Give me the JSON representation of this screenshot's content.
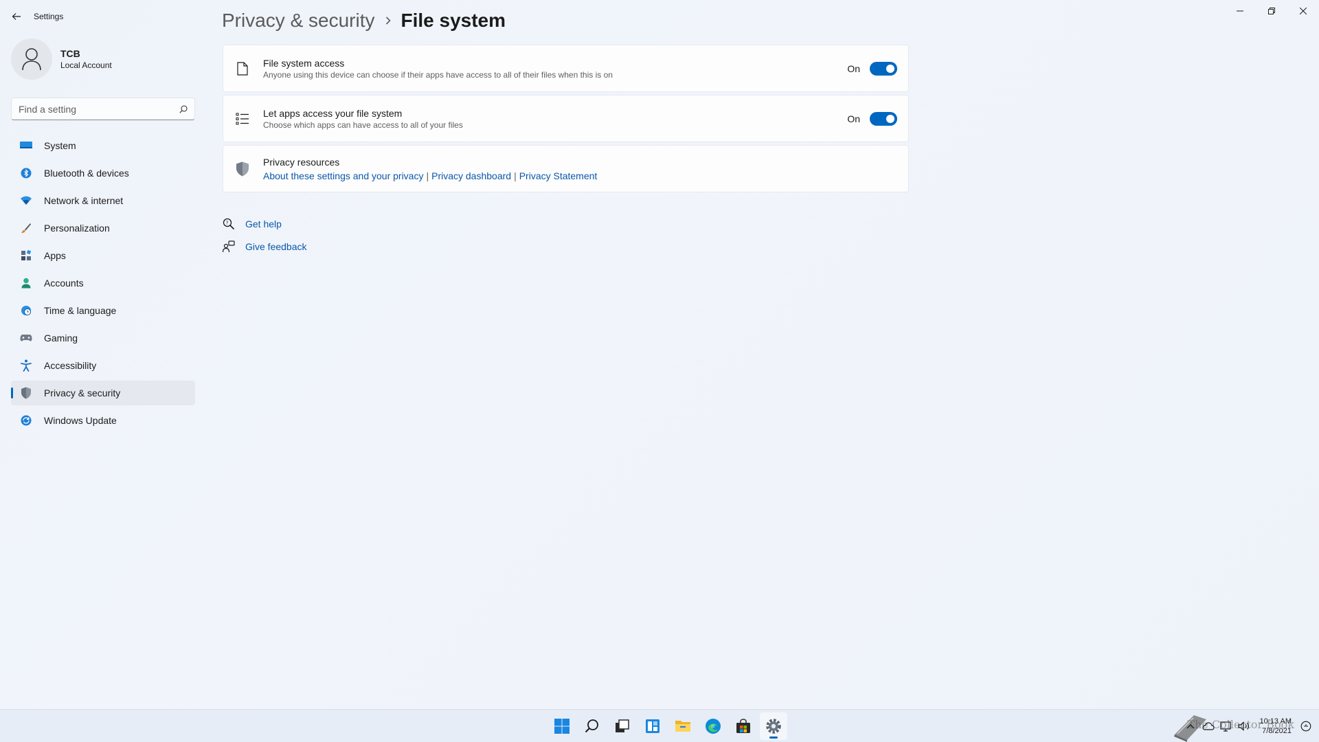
{
  "app": {
    "title": "Settings"
  },
  "profile": {
    "name": "TCB",
    "account_type": "Local Account"
  },
  "search": {
    "placeholder": "Find a setting"
  },
  "sidebar": {
    "items": [
      {
        "label": "System",
        "icon": "system-icon"
      },
      {
        "label": "Bluetooth & devices",
        "icon": "bluetooth-icon"
      },
      {
        "label": "Network & internet",
        "icon": "wifi-icon"
      },
      {
        "label": "Personalization",
        "icon": "brush-icon"
      },
      {
        "label": "Apps",
        "icon": "apps-icon"
      },
      {
        "label": "Accounts",
        "icon": "person-icon"
      },
      {
        "label": "Time & language",
        "icon": "globe-clock-icon"
      },
      {
        "label": "Gaming",
        "icon": "controller-icon"
      },
      {
        "label": "Accessibility",
        "icon": "accessibility-icon"
      },
      {
        "label": "Privacy & security",
        "icon": "shield-icon",
        "active": true
      },
      {
        "label": "Windows Update",
        "icon": "update-icon"
      }
    ]
  },
  "breadcrumb": {
    "parent": "Privacy & security",
    "current": "File system"
  },
  "cards": {
    "file_system_access": {
      "title": "File system access",
      "description": "Anyone using this device can choose if their apps have access to all of their files when this is on",
      "state_label": "On",
      "enabled": true
    },
    "let_apps_access": {
      "title": "Let apps access your file system",
      "description": "Choose which apps can have access to all of your files",
      "state_label": "On",
      "enabled": true
    },
    "privacy_resources": {
      "title": "Privacy resources",
      "links": [
        "About these settings and your privacy",
        "Privacy dashboard",
        "Privacy Statement"
      ],
      "separator": "|"
    }
  },
  "help": {
    "get_help": "Get help",
    "give_feedback": "Give feedback"
  },
  "taskbar": {
    "apps": [
      "start-icon",
      "search-icon",
      "task-view-icon",
      "widgets-icon",
      "file-explorer-icon",
      "edge-icon",
      "store-icon",
      "settings-icon"
    ],
    "time": "10:13 AM",
    "date": "7/8/2021",
    "watermark": "The Collector Book"
  },
  "colors": {
    "accent": "#0067c0",
    "link": "#0a58a8",
    "background": "#eef3fa"
  }
}
